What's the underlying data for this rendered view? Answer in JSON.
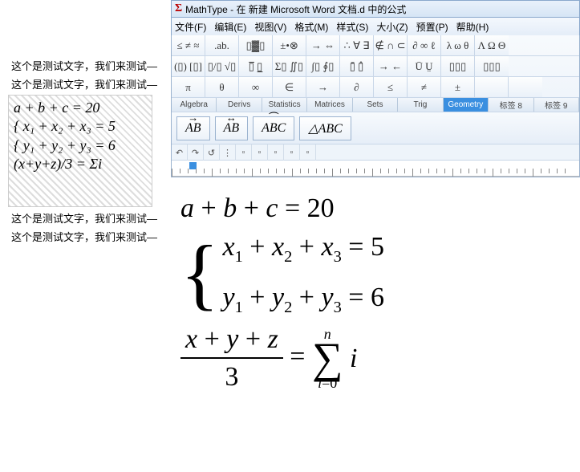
{
  "left": {
    "texts": [
      "这个是测试文字，我们来测试—",
      "这个是测试文字，我们来测试—",
      "这个是测试文字，我们来测试—",
      "这个是测试文字，我们来测试—"
    ],
    "formula": [
      "a + b + c = 20",
      "x₁ + x₂ + x₃ = 5",
      "y₁ + y₂ + y₃ = 6",
      "(x+y+z)/3 = Σi"
    ]
  },
  "window": {
    "title": "MathType - 在 新建 Microsoft Word 文档.d 中的公式"
  },
  "menubar": [
    "文件(F)",
    "编辑(E)",
    "视图(V)",
    "格式(M)",
    "样式(S)",
    "大小(Z)",
    "预置(P)",
    "帮助(H)"
  ],
  "toolbar_rows": [
    [
      "≤ ≠ ≈",
      ".ab.",
      "▯▓▯",
      "±•⊗",
      "→ ⇔",
      "∴ ∀ ∃",
      "∉ ∩ ⊂",
      "∂ ∞ ℓ",
      "λ ω θ",
      "Λ Ω Θ"
    ],
    [
      "(▯) [▯]",
      "▯/▯ √▯",
      "▯̅ ▯̲",
      "Σ▯ ∬▯",
      "∫▯ ∮▯",
      "▯̄ ▯̂",
      "→ ←",
      "Ū Ṳ",
      "▯▯▯",
      "▯▯▯"
    ],
    [
      "π",
      "θ",
      "∞",
      "∈",
      "→",
      "∂",
      "≤",
      "≠",
      "±",
      "",
      ""
    ]
  ],
  "tabs": [
    "Algebra",
    "Derivs",
    "Statistics",
    "Matrices",
    "Sets",
    "Trig",
    "Geometry",
    "标签 8",
    "标签 9"
  ],
  "active_tab": 6,
  "geom_buttons": [
    "AB",
    "AB",
    "ABC",
    "△ABC"
  ],
  "geom_overlines": [
    "→",
    "↔",
    "⏜",
    ""
  ],
  "small_toolbar": [
    "↶",
    "↷",
    "↺",
    "⋮",
    "▫",
    "▫",
    "▫",
    "▫",
    "▫",
    "▫",
    "",
    "",
    "",
    ""
  ],
  "equations": {
    "line1": "a + b + c = 20",
    "sys1": "x₁ + x₂ + x₃ = 5",
    "sys2": "y₁ + y₂ + y₃ = 6",
    "frac_num": "x + y + z",
    "frac_den": "3",
    "eq": "=",
    "sum_top": "n",
    "sum_bot": "i=0",
    "sum_body": "i"
  }
}
